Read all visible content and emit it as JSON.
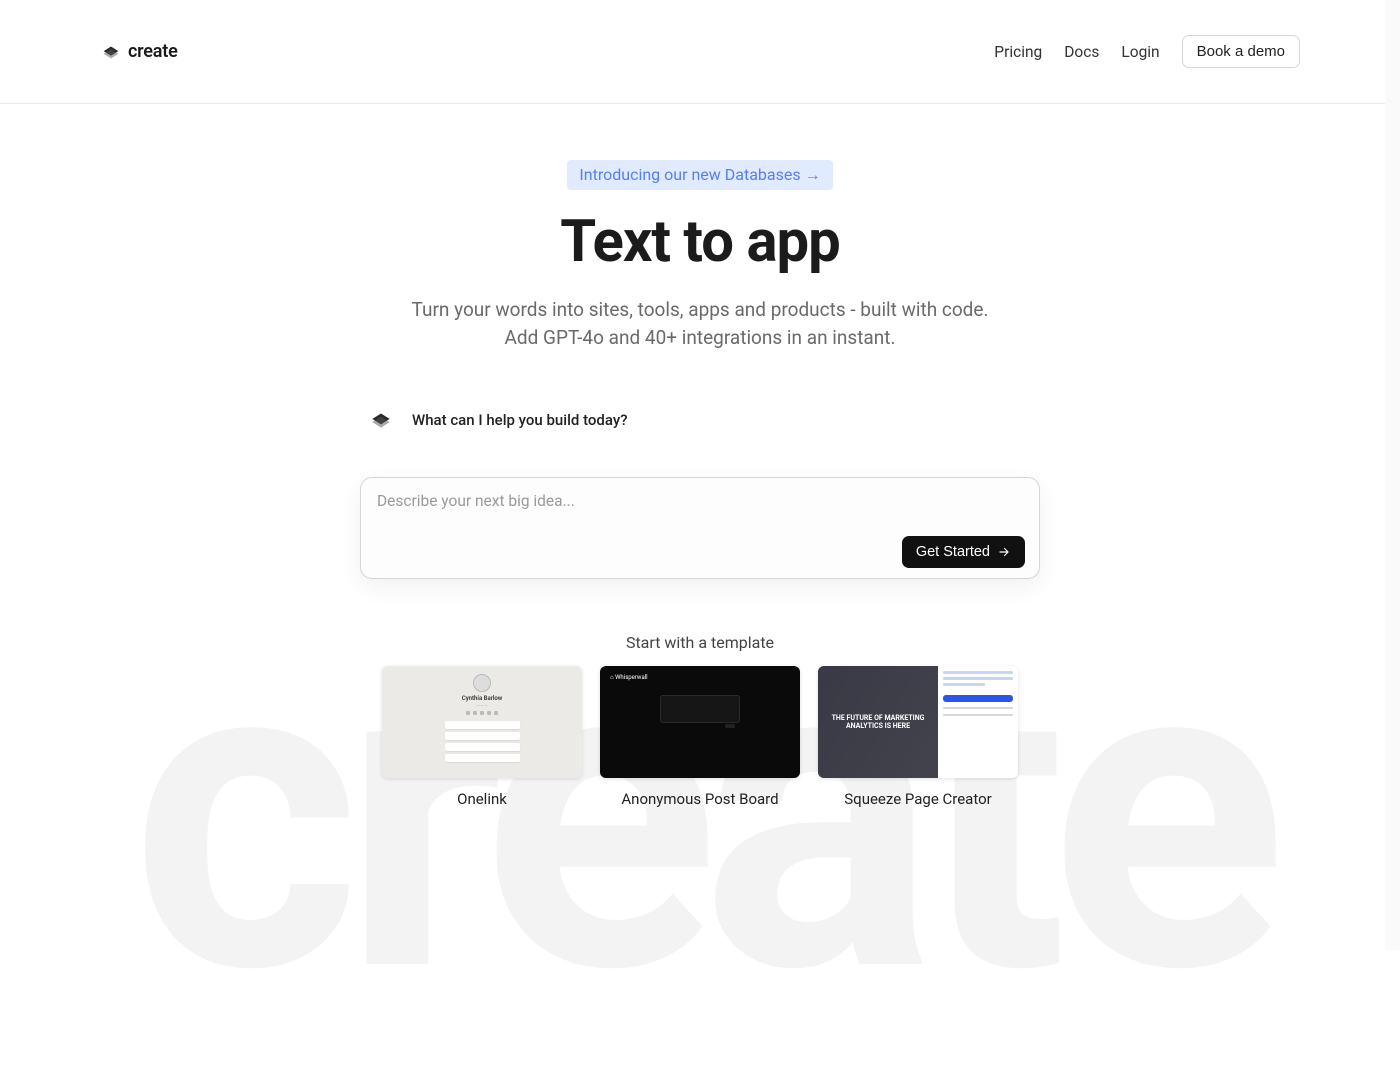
{
  "header": {
    "brand": "create",
    "nav": {
      "pricing": "Pricing",
      "docs": "Docs",
      "login": "Login",
      "demo": "Book a demo"
    }
  },
  "hero": {
    "banner": "Introducing our new Databases →",
    "title": "Text to app",
    "subtitle_line1": "Turn your words into sites, tools, apps and products - built with code.",
    "subtitle_line2": "Add GPT-4o and 40+ integrations in an instant."
  },
  "prompt": {
    "question": "What can I help you build today?",
    "placeholder": "Describe your next big idea...",
    "cta": "Get Started"
  },
  "templates": {
    "title": "Start with a template",
    "items": [
      {
        "label": "Onelink"
      },
      {
        "label": "Anonymous Post Board"
      },
      {
        "label": "Squeeze Page Creator"
      }
    ]
  },
  "thumb3_headline": "THE FUTURE OF MARKETING ANALYTICS IS HERE",
  "bg_word": "create"
}
